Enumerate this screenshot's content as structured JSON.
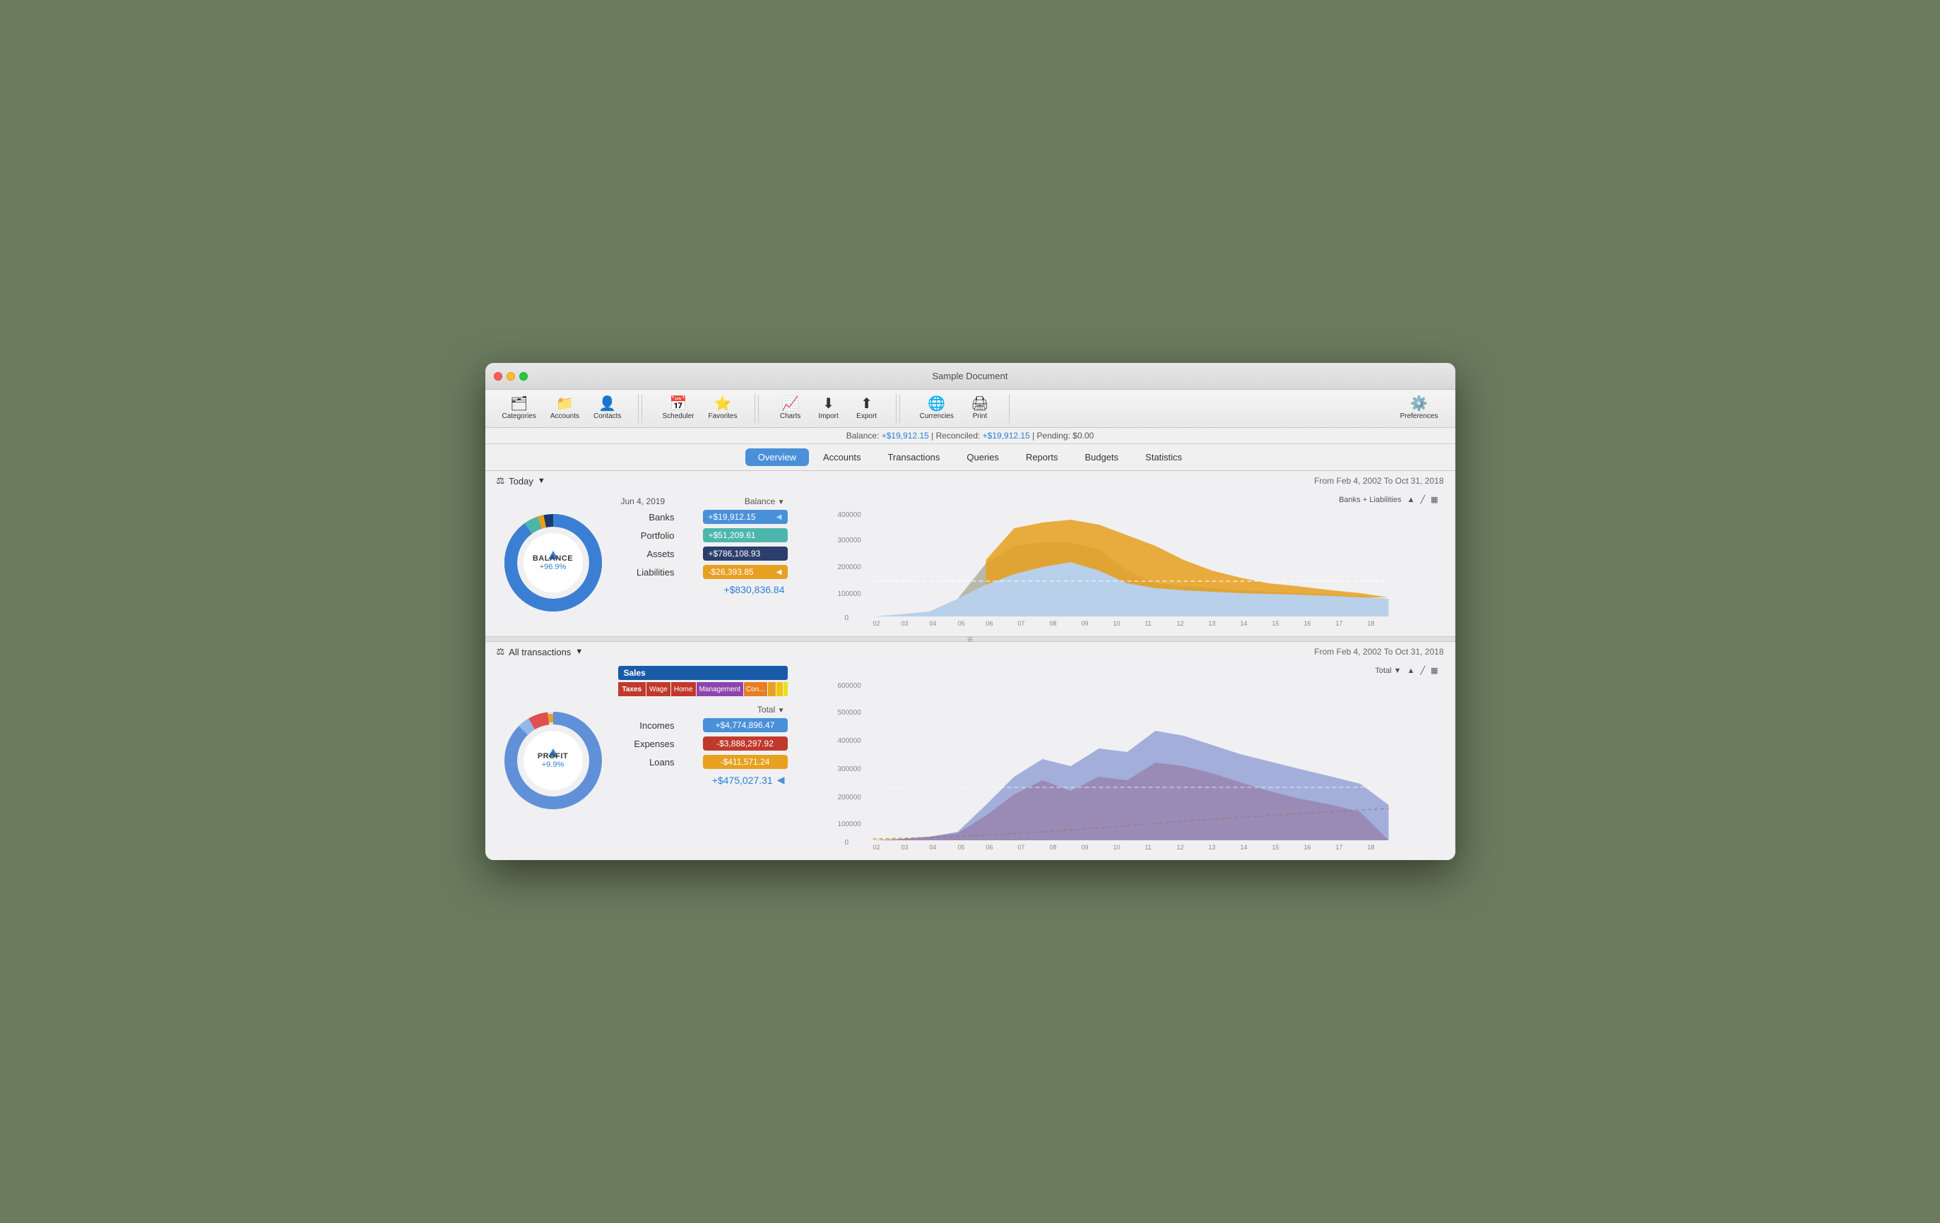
{
  "window": {
    "title": "Sample Document"
  },
  "toolbar": {
    "groups": [
      {
        "items": [
          {
            "id": "categories",
            "label": "Categories",
            "icon": "🗂"
          },
          {
            "id": "accounts",
            "label": "Accounts",
            "icon": "📁"
          },
          {
            "id": "contacts",
            "label": "Contacts",
            "icon": "👤"
          }
        ]
      },
      {
        "items": [
          {
            "id": "scheduler",
            "label": "Scheduler",
            "icon": "📅"
          },
          {
            "id": "favorites",
            "label": "Favorites",
            "icon": "⭐"
          }
        ]
      },
      {
        "items": [
          {
            "id": "charts",
            "label": "Charts",
            "icon": "📈"
          },
          {
            "id": "import",
            "label": "Import",
            "icon": "⬇"
          },
          {
            "id": "export",
            "label": "Export",
            "icon": "⬆"
          }
        ]
      },
      {
        "items": [
          {
            "id": "currencies",
            "label": "Currencies",
            "icon": "🌐"
          },
          {
            "id": "print",
            "label": "Print",
            "icon": "🖨"
          }
        ]
      }
    ],
    "preferences_label": "Preferences"
  },
  "balance_bar": {
    "label_balance": "Balance:",
    "balance_value": "+$19,912.15",
    "label_reconciled": "Reconciled:",
    "reconciled_value": "+$19,912.15",
    "label_pending": "Pending:",
    "pending_value": "$0.00"
  },
  "tabs": {
    "items": [
      "Overview",
      "Accounts",
      "Transactions",
      "Queries",
      "Reports",
      "Budgets",
      "Statistics"
    ],
    "active": "Overview"
  },
  "overview_section": {
    "title": "Today",
    "date_range": "From Feb 4, 2002 To Oct 31, 2018",
    "balance_date": "Jun 4, 2019",
    "balance_column": "Balance",
    "banks_label": "Banks",
    "banks_value": "+$19,912.15",
    "portfolio_label": "Portfolio",
    "portfolio_value": "+$51,209.61",
    "assets_label": "Assets",
    "assets_value": "+$786,108.93",
    "liabilities_label": "Liabilities",
    "liabilities_value": "-$26,393.85",
    "total": "+$830,836.84",
    "donut_label": "BALANCE",
    "donut_percent": "+96.9%",
    "chart_filter": "Banks + Liabilities",
    "chart_y_labels": [
      "400000",
      "300000",
      "200000",
      "100000",
      "0"
    ],
    "chart_x_labels": [
      "02",
      "03",
      "04",
      "05",
      "06",
      "07",
      "08",
      "09",
      "10",
      "11",
      "12",
      "13",
      "14",
      "15",
      "16",
      "17",
      "18"
    ]
  },
  "transactions_section": {
    "title": "All transactions",
    "date_range": "From Feb 4, 2002 To Oct 31, 2018",
    "profit_label": "PROFIT",
    "profit_percent": "+9.9%",
    "total_column": "Total",
    "incomes_label": "Incomes",
    "incomes_value": "+$4,774,896.47",
    "expenses_label": "Expenses",
    "expenses_value": "-$3,888,297.92",
    "loans_label": "Loans",
    "loans_value": "-$411,571.24",
    "total": "+$475,027.31",
    "sales_label": "Sales",
    "taxes_label": "Taxes",
    "wage_label": "Wage",
    "home_label": "Home",
    "management_label": "Management",
    "con_label": "Con...",
    "chart_filter": "Total",
    "chart_y_labels": [
      "600000",
      "500000",
      "400000",
      "300000",
      "200000",
      "100000",
      "0"
    ],
    "chart_x_labels": [
      "02",
      "03",
      "04",
      "05",
      "06",
      "07",
      "08",
      "09",
      "10",
      "11",
      "12",
      "13",
      "14",
      "15",
      "16",
      "17",
      "18"
    ]
  },
  "colors": {
    "blue_accent": "#4a90d9",
    "positive": "#2980d9",
    "orange": "#e8a020",
    "teal": "#4db6ac",
    "dark_blue": "#2c3e6b",
    "red": "#c0392b"
  }
}
